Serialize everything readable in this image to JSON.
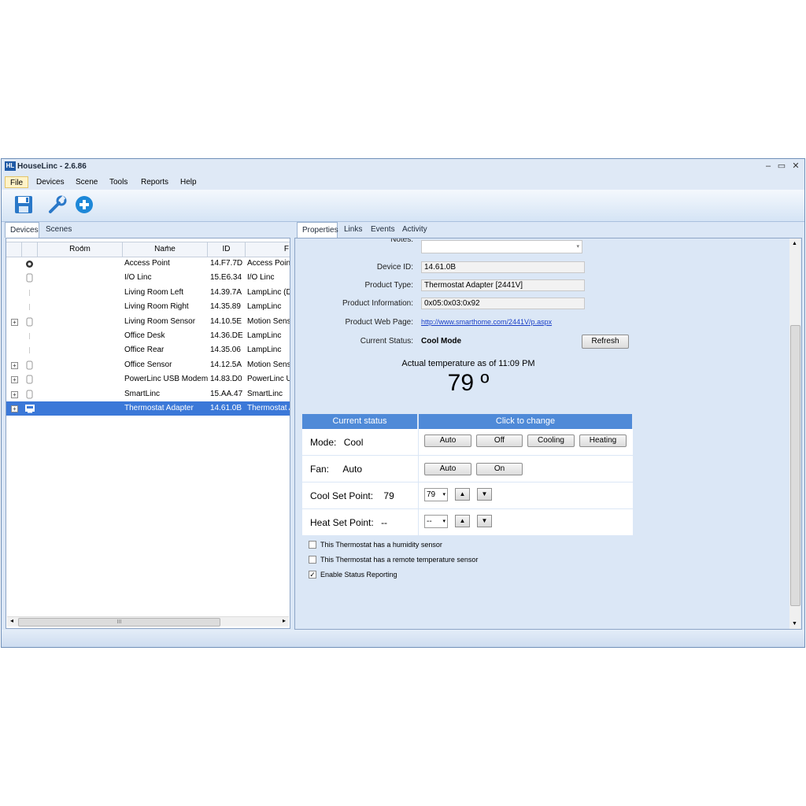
{
  "window": {
    "title": "HouseLinc - 2.6.86",
    "logo": "HL",
    "min": "–",
    "max": "▭",
    "close": "✕"
  },
  "menu": [
    "File",
    "Devices",
    "Scene",
    "Tools",
    "Reports",
    "Help"
  ],
  "toolbar": {
    "icons": [
      "save-icon",
      "wrench-icon",
      "add-icon"
    ]
  },
  "left_tabs": [
    "Devices",
    "Scenes"
  ],
  "device_grid": {
    "headers": {
      "room": "Room",
      "name": "Name",
      "id": "ID",
      "type": "F"
    },
    "rows": [
      {
        "expand": "",
        "icon": "access-point-icon",
        "room": "",
        "name": "Access Point",
        "id": "14.F7.7D",
        "type": "Access Point"
      },
      {
        "expand": "",
        "icon": "io-linc-icon",
        "room": "",
        "name": "I/O Linc",
        "id": "15.E6.34",
        "type": "I/O Linc"
      },
      {
        "expand": "",
        "icon": "lamp-icon",
        "room": "",
        "name": "Living Room Left",
        "id": "14.39.7A",
        "type": "LampLinc (Du"
      },
      {
        "expand": "",
        "icon": "lamp-icon",
        "room": "",
        "name": "Living Room Right",
        "id": "14.35.89",
        "type": "LampLinc"
      },
      {
        "expand": "+",
        "icon": "motion-sensor-icon",
        "room": "",
        "name": "Living Room Sensor",
        "id": "14.10.5E",
        "type": "Motion Senso"
      },
      {
        "expand": "",
        "icon": "lamp-icon",
        "room": "",
        "name": "Office Desk",
        "id": "14.36.DE",
        "type": "LampLinc"
      },
      {
        "expand": "",
        "icon": "lamp-icon",
        "room": "",
        "name": "Office Rear",
        "id": "14.35.06",
        "type": "LampLinc"
      },
      {
        "expand": "+",
        "icon": "motion-sensor-icon",
        "room": "",
        "name": "Office Sensor",
        "id": "14.12.5A",
        "type": "Motion Senso"
      },
      {
        "expand": "+",
        "icon": "modem-icon",
        "room": "",
        "name": "PowerLinc USB Modem (...",
        "id": "14.83.D0",
        "type": "PowerLinc US"
      },
      {
        "expand": "+",
        "icon": "smartlinc-icon",
        "room": "",
        "name": "SmartLinc",
        "id": "15.AA.47",
        "type": "SmartLinc"
      },
      {
        "expand": "+",
        "icon": "thermostat-icon",
        "room": "",
        "name": "Thermostat Adapter",
        "id": "14.61.0B",
        "type": "Thermostat A"
      }
    ],
    "selected_index": 10,
    "scroll_grip": "III"
  },
  "right_tabs": [
    "Properties",
    "Links",
    "Events",
    "Activity"
  ],
  "properties": {
    "notes_label": "Notes:",
    "device_id_label": "Device ID:",
    "device_id": "14.61.0B",
    "product_type_label": "Product Type:",
    "product_type": "Thermostat Adapter [2441V]",
    "product_info_label": "Product Information:",
    "product_info": "0x05:0x03:0x92",
    "web_page_label": "Product Web Page:",
    "web_page": "http://www.smarthome.com/2441V/p.aspx",
    "status_label": "Current Status:",
    "status": "Cool Mode",
    "refresh": "Refresh",
    "actual_temp_caption": "Actual temperature as of 11:09 PM",
    "actual_temp": "79 º"
  },
  "status_table": {
    "head_left": "Current status",
    "head_right": "Click to change",
    "mode_label": "Mode:",
    "mode_value": "Cool",
    "mode_buttons": [
      "Auto",
      "Off",
      "Cooling",
      "Heating"
    ],
    "fan_label": "Fan:",
    "fan_value": "Auto",
    "fan_buttons": [
      "Auto",
      "On"
    ],
    "cool_label": "Cool Set Point:",
    "cool_value": "79",
    "cool_select": "79",
    "heat_label": "Heat Set Point:",
    "heat_value": "--",
    "heat_select": "--"
  },
  "checkboxes": [
    {
      "label": "This Thermostat has a humidity sensor",
      "checked": false
    },
    {
      "label": "This Thermostat has a remote temperature sensor",
      "checked": false
    },
    {
      "label": "Enable Status Reporting",
      "checked": true
    }
  ],
  "colors": {
    "accent": "#4f8ad8",
    "selection": "#3b78d8",
    "link": "#1a3fc7"
  }
}
